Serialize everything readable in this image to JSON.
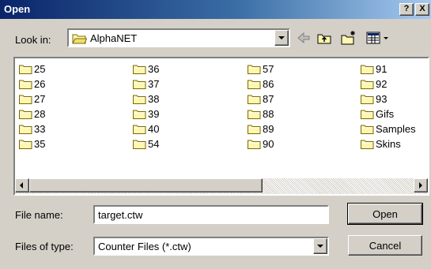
{
  "window": {
    "title": "Open",
    "help_label": "?",
    "close_label": "X",
    "title_gradient": [
      "#0a246a",
      "#a6caf0"
    ]
  },
  "lookin": {
    "label": "Look in:",
    "value": "AlphaNET",
    "toolbar": [
      "back-icon",
      "up-folder-icon",
      "new-folder-icon",
      "view-menu-icon"
    ]
  },
  "files": {
    "items": [
      {
        "name": "25",
        "icon": "folder-icon"
      },
      {
        "name": "26",
        "icon": "folder-icon"
      },
      {
        "name": "27",
        "icon": "folder-icon"
      },
      {
        "name": "28",
        "icon": "folder-icon"
      },
      {
        "name": "33",
        "icon": "folder-icon"
      },
      {
        "name": "35",
        "icon": "folder-icon"
      },
      {
        "name": "36",
        "icon": "folder-icon"
      },
      {
        "name": "37",
        "icon": "folder-icon"
      },
      {
        "name": "38",
        "icon": "folder-icon"
      },
      {
        "name": "39",
        "icon": "folder-icon"
      },
      {
        "name": "40",
        "icon": "folder-icon"
      },
      {
        "name": "54",
        "icon": "folder-icon"
      },
      {
        "name": "57",
        "icon": "folder-icon"
      },
      {
        "name": "86",
        "icon": "folder-icon"
      },
      {
        "name": "87",
        "icon": "folder-icon"
      },
      {
        "name": "88",
        "icon": "folder-icon"
      },
      {
        "name": "89",
        "icon": "folder-icon"
      },
      {
        "name": "90",
        "icon": "folder-icon"
      },
      {
        "name": "91",
        "icon": "folder-icon"
      },
      {
        "name": "92",
        "icon": "folder-icon"
      },
      {
        "name": "93",
        "icon": "folder-icon"
      },
      {
        "name": "Gifs",
        "icon": "folder-icon"
      },
      {
        "name": "Samples",
        "icon": "folder-icon"
      },
      {
        "name": "Skins",
        "icon": "folder-icon"
      }
    ]
  },
  "form": {
    "filename_label": "File name:",
    "filename_value": "target.ctw",
    "filetype_label": "Files of type:",
    "filetype_value": "Counter Files (*.ctw)",
    "open_label": "Open",
    "cancel_label": "Cancel"
  }
}
